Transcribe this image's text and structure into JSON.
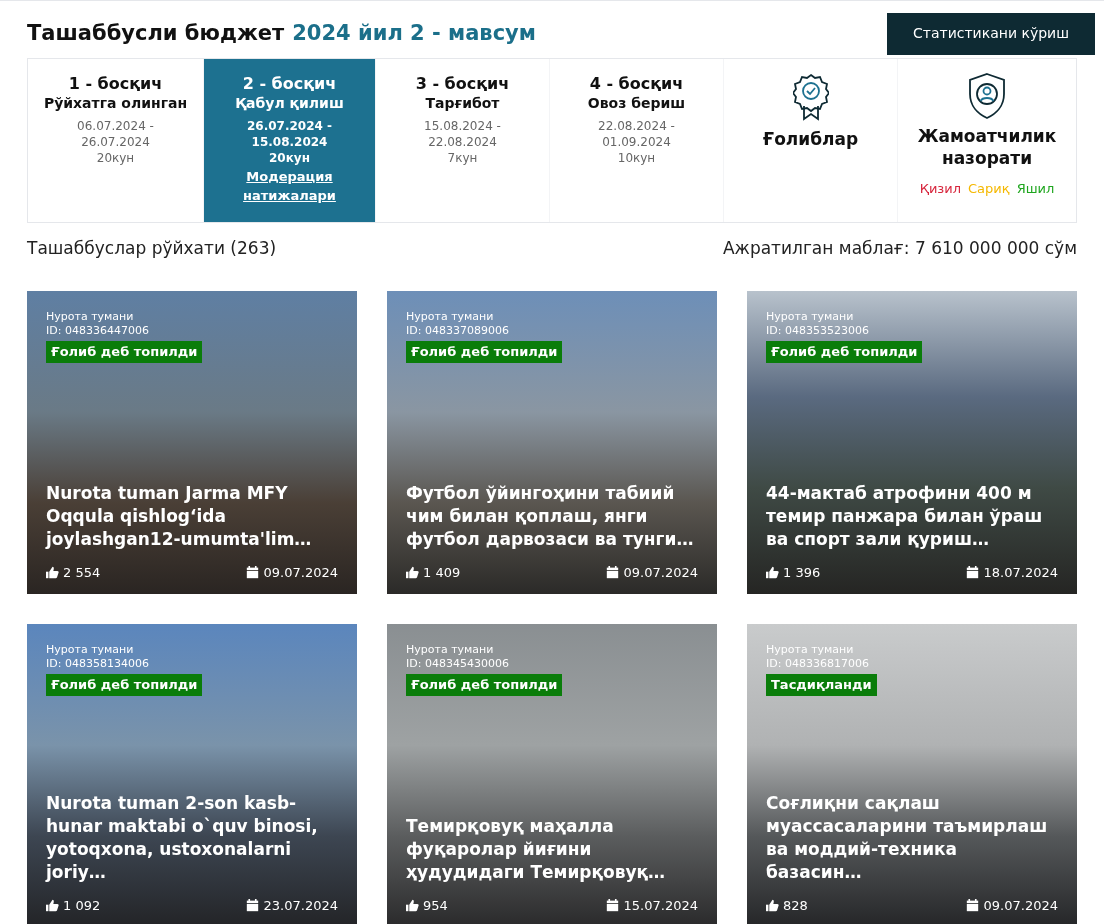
{
  "header": {
    "title": "Ташаббусли бюджет",
    "season": "2024 йил 2 - мавсум",
    "stats_button": "Статистикани кўриш"
  },
  "stages": [
    {
      "kind": "stage",
      "number": "1 - босқич",
      "name": "Рўйхатга олинган",
      "dates": [
        "06.07.2024 -",
        "26.07.2024",
        "20кун"
      ],
      "selected": false
    },
    {
      "kind": "stage",
      "number": "2 - босқич",
      "name": "Қабул қилиш",
      "dates": [
        "26.07.2024 -",
        "15.08.2024",
        "20кун"
      ],
      "link": "Модерация натижалари",
      "selected": true
    },
    {
      "kind": "stage",
      "number": "3 - босқич",
      "name": "Тарғибот",
      "dates": [
        "15.08.2024 -",
        "22.08.2024",
        "7кун"
      ],
      "selected": false
    },
    {
      "kind": "stage",
      "number": "4 - босқич",
      "name": "Овоз бериш",
      "dates": [
        "22.08.2024 -",
        "01.09.2024",
        "10кун"
      ],
      "selected": false
    },
    {
      "kind": "winners",
      "name": "Ғолиблар"
    },
    {
      "kind": "control",
      "name": "Жамоатчилик назорати",
      "legend": [
        {
          "label": "Қизил",
          "color": "#d7263d"
        },
        {
          "label": "Сариқ",
          "color": "#f5b800"
        },
        {
          "label": "Яшил",
          "color": "#1fa61f"
        }
      ]
    }
  ],
  "list_title": "Ташаббуслар рўйхати (263)",
  "budget": "Ажратилган маблағ: 7 610 000 000 сўм",
  "cards": [
    {
      "district": "Нурота тумани",
      "id": "ID: 048336447006",
      "status": "Ғолиб деб топилди",
      "title": "Nurota tuman Jarma MFY Oqqula qishlog‘ida joylashgan12-umumta'lim…",
      "likes": "2 554",
      "date": "09.07.2024"
    },
    {
      "district": "Нурота тумани",
      "id": "ID: 048337089006",
      "status": "Ғолиб деб топилди",
      "title": "Футбол ўйингоҳини табиий чим билан қоплаш, янги футбол дарвозаси ва тунги…",
      "likes": "1 409",
      "date": "09.07.2024"
    },
    {
      "district": "Нурота тумани",
      "id": "ID: 048353523006",
      "status": "Ғолиб деб топилди",
      "title": "44-мактаб атрофини 400 м темир панжара билан ўраш ва спорт зали қуриш…",
      "likes": "1 396",
      "date": "18.07.2024"
    },
    {
      "district": "Нурота тумани",
      "id": "ID: 048358134006",
      "status": "Ғолиб деб топилди",
      "title": "Nurota tuman 2-son kasb-hunar maktabi o`quv binosi, yotoqxona, ustoxonalarni joriy…",
      "likes": "1 092",
      "date": "23.07.2024"
    },
    {
      "district": "Нурота тумани",
      "id": "ID: 048345430006",
      "status": "Ғолиб деб топилди",
      "title": "Темирқовуқ маҳалла фуқаролар йиғини ҳудудидаги Темирқовуқ…",
      "likes": "954",
      "date": "15.07.2024"
    },
    {
      "district": "Нурота тумани",
      "id": "ID: 048336817006",
      "status": "Тасдиқланди",
      "title": "Соғлиқни сақлаш муассасаларини таъмирлаш ва моддий-техника базасин…",
      "likes": "828",
      "date": "09.07.2024"
    }
  ]
}
